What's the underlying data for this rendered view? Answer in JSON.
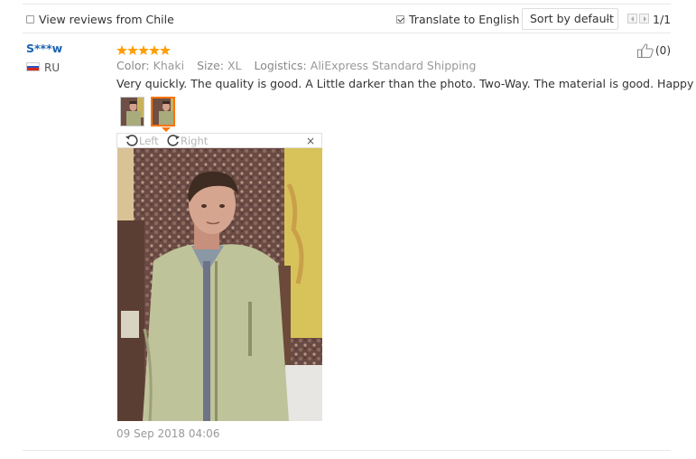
{
  "filters": {
    "view_reviews_label": "View reviews from Chile",
    "view_reviews_checked": false,
    "translate_label": "Translate to English",
    "translate_checked": true
  },
  "sort": {
    "selected": "Sort by default"
  },
  "pagination": {
    "text": "1/1"
  },
  "review": {
    "user": "S***w",
    "country": "RU",
    "rating": 5,
    "color_label": "Color:",
    "color_value": "Khaki",
    "size_label": "Size:",
    "size_value": "XL",
    "logistics_label": "Logistics:",
    "logistics_value": "AliExpress Standard Shipping",
    "text": "Very quickly. The quality is good. A Little darker than the photo. Two-Way. The material is good. Happy",
    "helpful_count": "(0)",
    "date": "09 Sep 2018 04:06"
  },
  "viewer": {
    "rotate_left": "Left",
    "rotate_right": "Right",
    "close": "×"
  },
  "colors": {
    "accent": "#ff7300",
    "username": "#1a62b3",
    "star": "#ff9d00"
  }
}
